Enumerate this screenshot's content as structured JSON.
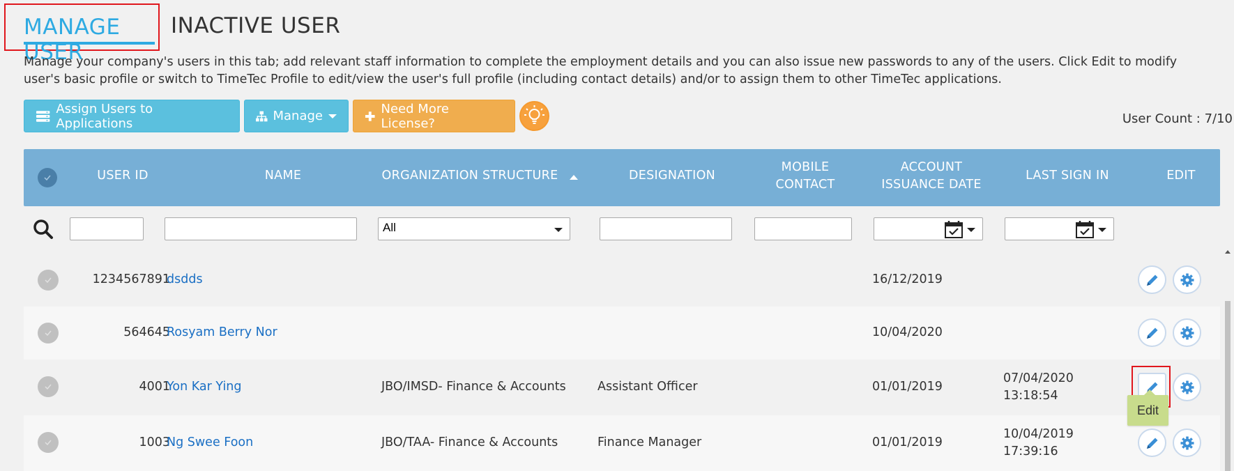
{
  "tabs": {
    "active_label": "MANAGE USER",
    "inactive_label": "INACTIVE USER"
  },
  "description": "Manage your company's users in this tab; add relevant staff information to complete the employment details and you can also issue new passwords to any of the users. Click Edit to modify user's basic profile or switch to TimeTec Profile to edit/view the user's full profile (including contact details) and/or to assign them to other TimeTec applications.",
  "toolbar": {
    "assign_label": "Assign Users to Applications",
    "manage_label": "Manage",
    "license_label": "Need More License?",
    "user_count": "User Count : 7/10"
  },
  "table": {
    "headers": {
      "user_id": "USER ID",
      "name": "NAME",
      "org": "ORGANIZATION STRUCTURE",
      "designation": "DESIGNATION",
      "mobile_1": "MOBILE",
      "mobile_2": "CONTACT",
      "issuance_1": "ACCOUNT",
      "issuance_2": "ISSUANCE DATE",
      "last_sign_in": "LAST SIGN IN",
      "edit": "EDIT"
    },
    "filters": {
      "org_selected": "All"
    },
    "rows": [
      {
        "user_id": "1234567891",
        "name": "dsdds",
        "org": "",
        "designation": "",
        "mobile": "",
        "issuance": "16/12/2019",
        "last_sign_in_date": "",
        "last_sign_in_time": ""
      },
      {
        "user_id": "564645",
        "name": "Rosyam Berry Nor",
        "org": "",
        "designation": "",
        "mobile": "",
        "issuance": "10/04/2020",
        "last_sign_in_date": "",
        "last_sign_in_time": ""
      },
      {
        "user_id": "4001",
        "name": "Yon Kar Ying",
        "org": "JBO/IMSD- Finance & Accounts",
        "designation": "Assistant Officer",
        "mobile": "",
        "issuance": "01/01/2019",
        "last_sign_in_date": "07/04/2020",
        "last_sign_in_time": "13:18:54"
      },
      {
        "user_id": "1003",
        "name": "Ng Swee Foon",
        "org": "JBO/TAA- Finance & Accounts",
        "designation": "Finance Manager",
        "mobile": "",
        "issuance": "01/01/2019",
        "last_sign_in_date": "10/04/2019",
        "last_sign_in_time": "17:39:16"
      }
    ]
  },
  "tooltip": {
    "label": "Edit"
  },
  "icons": {
    "search": "search-icon",
    "calendar": "calendar-icon",
    "edit": "pencil-icon",
    "settings": "gear-icon",
    "bulb": "lightbulb-icon"
  },
  "colors": {
    "accent": "#2eaae2",
    "header_bg": "#77afd6",
    "button_blue": "#5bc0de",
    "button_orange": "#f0ad4e",
    "link": "#1a6fc4",
    "highlight_red": "#e0161c",
    "tooltip_bg": "#c8dc8c"
  }
}
